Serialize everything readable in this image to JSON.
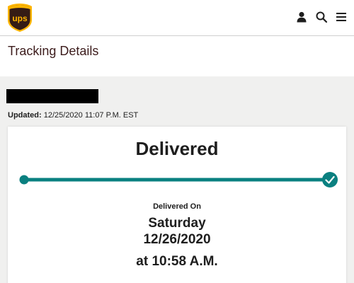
{
  "header": {
    "logo_text": "ups",
    "icons": {
      "account": "person-icon",
      "search": "search-icon",
      "menu": "menu-icon"
    }
  },
  "page": {
    "title": "Tracking Details"
  },
  "tracking": {
    "updated_label": "Updated:",
    "updated_value": "12/25/2020 11:07 P.M. EST",
    "status": "Delivered",
    "progress_percent": 100,
    "delivered_on_label": "Delivered On",
    "day": "Saturday",
    "date": "12/26/2020",
    "time": "at 10:58 A.M."
  },
  "colors": {
    "brand_brown": "#351c15",
    "brand_gold": "#ffb500",
    "progress_teal": "#0a8080",
    "background_gray": "#f0f0ef"
  }
}
